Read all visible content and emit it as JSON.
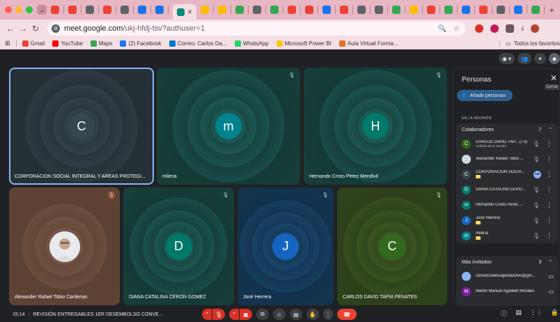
{
  "browser": {
    "url_host": "meet.google.com",
    "url_path": "/ukj-hfdj-tsv?authuser=1",
    "tab_favicon_colors": [
      "#ea4335",
      "#ea4335",
      "#5f6368",
      "#ea4335",
      "#5f6368",
      "#1a73e8",
      "#1a73e8",
      "#fbbc04",
      "#fbbc04",
      "#34a853",
      "#5f6368",
      "#34a853",
      "#ea4335",
      "#ea4335",
      "#1a73e8",
      "#ea4335",
      "#5f6368",
      "#5f6368",
      "#34a853",
      "#fbbc04",
      "#ea4335",
      "#34a853",
      "#1a73e8",
      "#ea4335",
      "#5f6368",
      "#1a73e8",
      "#34a853",
      "#fbbc04",
      "#34a853"
    ],
    "bookmarks": [
      {
        "label": "Gmail",
        "color": "#ea4335"
      },
      {
        "label": "YouTube",
        "color": "#ff0000"
      },
      {
        "label": "Maps",
        "color": "#34a853"
      },
      {
        "label": "(2) Facebook",
        "color": "#1877f2"
      },
      {
        "label": "Correo: Carlos Da...",
        "color": "#0078d4"
      },
      {
        "label": "WhatsApp",
        "color": "#25d366"
      },
      {
        "label": "Microsoft Power BI",
        "color": "#f2c811"
      },
      {
        "label": "Aula Virtual Forma...",
        "color": "#e37222"
      }
    ],
    "bookmarks_right": "Todos los favoritos"
  },
  "tiles": [
    {
      "name": "CORPORACION SOCIAL INTEGRAL Y AREAS PROTEGI...",
      "initial": "C",
      "avatar_color": "#37474f",
      "bg": "ripple-slate",
      "active": true
    },
    {
      "name": "milena",
      "initial": "m",
      "avatar_color": "#00838f",
      "bg": "ripple-teal",
      "muted": true
    },
    {
      "name": "Hernando Cristo Perez Mendivil",
      "initial": "H",
      "avatar_color": "#00796b",
      "bg": "ripple-teal",
      "muted": true
    },
    {
      "name": "Alexander Rafael Tobio Cardenas",
      "initial": "",
      "avatar_color": "#cfd8dc",
      "bg": "ripple-brown",
      "muted": true,
      "photo": true
    },
    {
      "name": "DIANA CATALINA CERON GOMEZ",
      "initial": "D",
      "avatar_color": "#00796b",
      "bg": "ripple-teal",
      "muted": true
    },
    {
      "name": "José Herrera",
      "initial": "J",
      "avatar_color": "#1565c0",
      "bg": "ripple-blue",
      "muted": true
    },
    {
      "name": "CARLOS DAVID TAPIA PENATES",
      "initial": "C",
      "avatar_color": "#33691e",
      "bg": "ripple-green",
      "muted": true
    }
  ],
  "panel": {
    "title": "Personas",
    "close_tooltip": "Cerrar",
    "add_label": "Añadir personas",
    "section_label": "EN LA REUNIÓN",
    "collaborators": {
      "label": "Colaboradores",
      "count": "7",
      "people": [
        {
          "name": "CARLOS DAVID TAP... (Tú)",
          "sub": "Anfitrión de la reunión",
          "initial": "C",
          "color": "#33691e",
          "action": "mic"
        },
        {
          "name": "Alexander Rafael Tobio ...",
          "sub": "",
          "initial": "",
          "color": "#cfd8dc",
          "action": "mic"
        },
        {
          "name": "CORPORACION SOCIA...",
          "sub": "",
          "initial": "C",
          "color": "#37474f",
          "action": "dots",
          "badge": true
        },
        {
          "name": "DIANA CATALINA CERO...",
          "sub": "",
          "initial": "D",
          "color": "#00796b",
          "action": "mic"
        },
        {
          "name": "Hernando Cristo Perez ...",
          "sub": "",
          "initial": "H",
          "color": "#00796b",
          "action": "mic"
        },
        {
          "name": "José Herrera",
          "sub": "",
          "initial": "J",
          "color": "#1565c0",
          "action": "mic",
          "badge": true
        },
        {
          "name": "milena",
          "sub": "",
          "initial": "m",
          "color": "#00838f",
          "action": "mic",
          "badge": true
        }
      ]
    },
    "invited": {
      "label": "Más invitados",
      "count": "3",
      "people": [
        {
          "name": "consorcioencaproductivo@gm...",
          "initial": "",
          "color": "#8ab4f8"
        },
        {
          "name": "Martin Manuel Agudelo Morales",
          "initial": "M",
          "color": "#7b1fa2"
        }
      ]
    }
  },
  "bottom": {
    "time": "15:14",
    "meeting_name": "REVISIÓN ENTREGABLES 1ER DESEMBOLSO CONVE..."
  }
}
